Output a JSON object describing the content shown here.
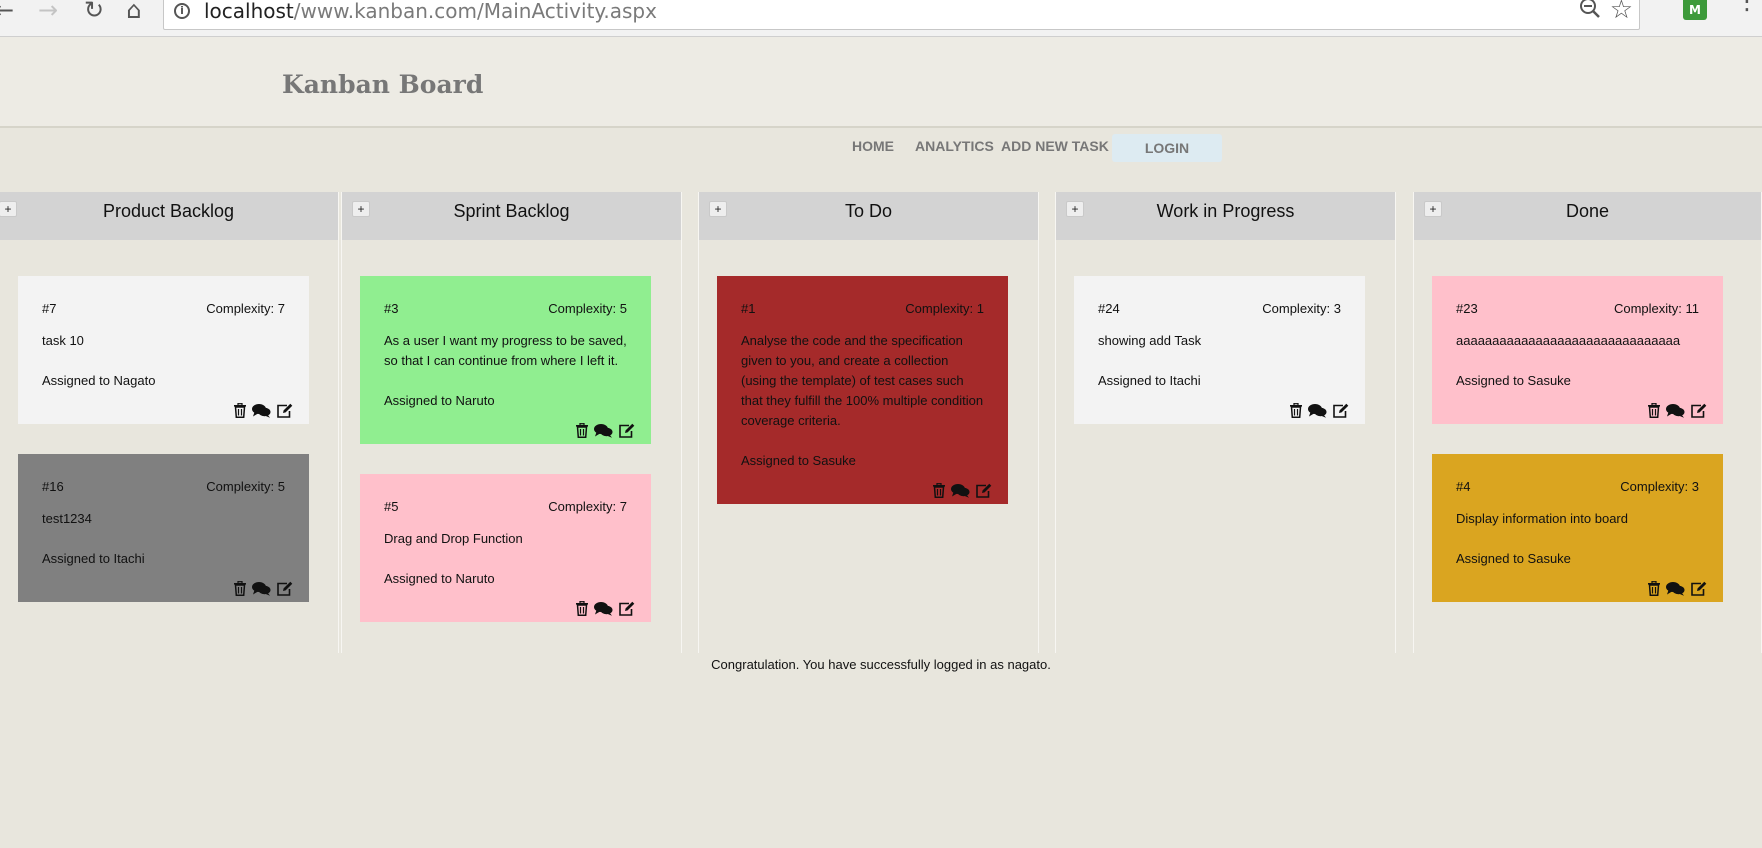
{
  "browser": {
    "url_host": "localhost",
    "url_path": "/www.kanban.com/MainActivity.aspx",
    "extension_letter": "M"
  },
  "header": {
    "title": "Kanban Board"
  },
  "nav": {
    "home": "HOME",
    "analytics": "ANALYTICS",
    "add_task": "ADD NEW TASK",
    "login": "LOGIN"
  },
  "colors": {
    "white": "#f3f3f3",
    "gray": "#808080",
    "green": "#90ee90",
    "pink": "#ffc0cb",
    "red": "#a52a2a",
    "gold": "#daa520"
  },
  "columns": [
    {
      "title": "Product Backlog",
      "add_label": "+",
      "cards": [
        {
          "id": "#7",
          "complexity": "Complexity: 7",
          "description": "task 10",
          "assignee": "Assigned to Nagato",
          "color": "#f3f3f3"
        },
        {
          "id": "#16",
          "complexity": "Complexity: 5",
          "description": "test1234",
          "assignee": "Assigned to Itachi",
          "color": "#808080"
        }
      ]
    },
    {
      "title": "Sprint Backlog",
      "add_label": "+",
      "cards": [
        {
          "id": "#3",
          "complexity": "Complexity: 5",
          "description": "As a user I want my progress to be saved, so that I can continue from where I left it.",
          "assignee": "Assigned to Naruto",
          "color": "#90ee90"
        },
        {
          "id": "#5",
          "complexity": "Complexity: 7",
          "description": "Drag and Drop Function",
          "assignee": "Assigned to Naruto",
          "color": "#ffc0cb"
        }
      ]
    },
    {
      "title": "To Do",
      "add_label": "+",
      "cards": [
        {
          "id": "#1",
          "complexity": "Complexity: 1",
          "description": "Analyse the code and the specification given to you, and create a collection (using the template) of test cases such that they fulfill the 100% multiple condition coverage criteria.",
          "assignee": "Assigned to Sasuke",
          "color": "#a52a2a"
        }
      ]
    },
    {
      "title": "Work in Progress",
      "add_label": "+",
      "cards": [
        {
          "id": "#24",
          "complexity": "Complexity: 3",
          "description": "showing add Task",
          "assignee": "Assigned to Itachi",
          "color": "#f3f3f3"
        }
      ]
    },
    {
      "title": "Done",
      "add_label": "+",
      "cards": [
        {
          "id": "#23",
          "complexity": "Complexity: 11",
          "description": "aaaaaaaaaaaaaaaaaaaaaaaaaaaaaaa",
          "assignee": "Assigned to Sasuke",
          "color": "#ffc0cb"
        },
        {
          "id": "#4",
          "complexity": "Complexity: 3",
          "description": "Display information into board",
          "assignee": "Assigned to Sasuke",
          "color": "#daa520"
        }
      ]
    }
  ],
  "card_actions": {
    "delete_icon": "trash-icon",
    "comment_icon": "comments-icon",
    "edit_icon": "edit-icon"
  },
  "status_message": "Congratulation. You have successfully logged in as nagato."
}
